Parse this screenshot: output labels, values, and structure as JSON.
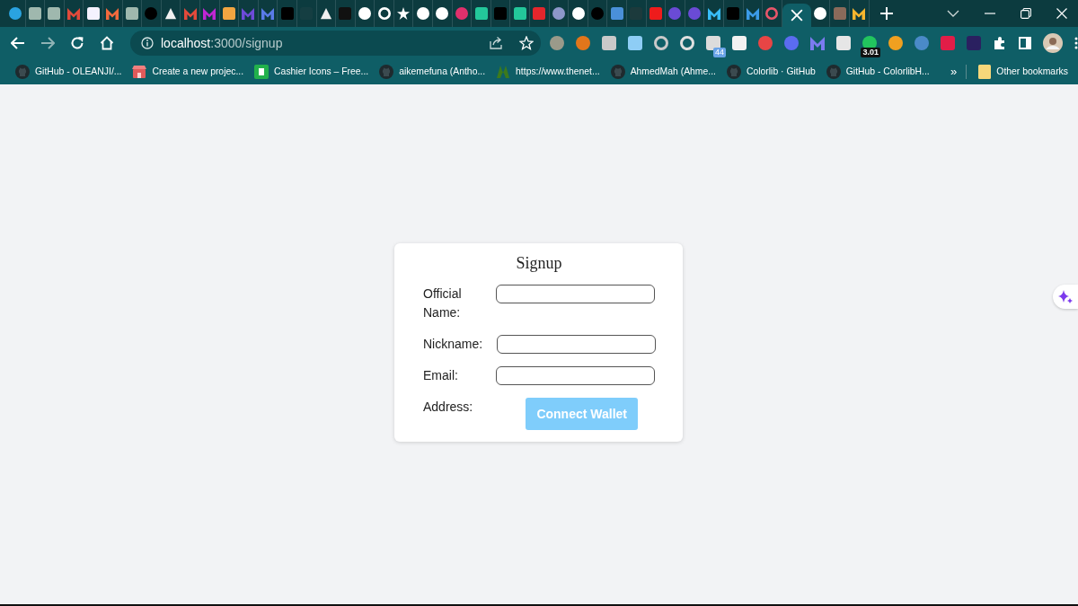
{
  "browser": {
    "tabs": [
      {
        "kind": "circle",
        "color": "#2aa3e0",
        "selected": false
      },
      {
        "kind": "square",
        "color": "#9fb8ae",
        "selected": false
      },
      {
        "kind": "square",
        "color": "#9fb8ae",
        "selected": false
      },
      {
        "kind": "mark",
        "color": "#e24a3b",
        "selected": false
      },
      {
        "kind": "square",
        "color": "#f4f2ff",
        "selected": false
      },
      {
        "kind": "mark",
        "color": "#f26a3d",
        "selected": false
      },
      {
        "kind": "square",
        "color": "#9fb8ae",
        "selected": false
      },
      {
        "kind": "circle",
        "color": "#000000",
        "selected": false
      },
      {
        "kind": "triangle",
        "color": "#f0f0f0",
        "selected": false
      },
      {
        "kind": "mark",
        "color": "#e24a3b",
        "selected": false
      },
      {
        "kind": "mark",
        "color": "#c026d3",
        "selected": false
      },
      {
        "kind": "square",
        "color": "#f2a541",
        "selected": false
      },
      {
        "kind": "mark",
        "color": "#6d4bd8",
        "selected": false
      },
      {
        "kind": "mark",
        "color": "#5a7be8",
        "selected": false
      },
      {
        "kind": "square",
        "color": "#000000",
        "selected": false
      },
      {
        "kind": "square",
        "color": "#153e42",
        "selected": false
      },
      {
        "kind": "triangle",
        "color": "#f0f0f0",
        "selected": false
      },
      {
        "kind": "square",
        "color": "#111111",
        "selected": false
      },
      {
        "kind": "circle",
        "color": "#ffffff",
        "selected": false
      },
      {
        "kind": "ring",
        "color": "#ffffff",
        "selected": false
      },
      {
        "kind": "star",
        "color": "#ffffff",
        "selected": false
      },
      {
        "kind": "circle",
        "color": "#ffffff",
        "selected": false
      },
      {
        "kind": "circle",
        "color": "#ffffff",
        "selected": false
      },
      {
        "kind": "circle",
        "color": "#e0306c",
        "selected": false
      },
      {
        "kind": "square",
        "color": "#23c79a",
        "selected": false
      },
      {
        "kind": "square",
        "color": "#000000",
        "selected": false
      },
      {
        "kind": "square",
        "color": "#23c79a",
        "selected": false
      },
      {
        "kind": "square",
        "color": "#e3262c",
        "selected": false
      },
      {
        "kind": "circle",
        "color": "#8d97c9",
        "selected": false
      },
      {
        "kind": "circle",
        "color": "#ffffff",
        "selected": false
      },
      {
        "kind": "circle",
        "color": "#000000",
        "selected": false
      },
      {
        "kind": "square",
        "color": "#4a90d9",
        "selected": false
      },
      {
        "kind": "square",
        "color": "#1c3a3c",
        "selected": false
      },
      {
        "kind": "square",
        "color": "#ee1c1c",
        "selected": false
      },
      {
        "kind": "circle",
        "color": "#6a4bd6",
        "selected": false
      },
      {
        "kind": "circle",
        "color": "#6a4bd6",
        "selected": false
      },
      {
        "kind": "mark",
        "color": "#38bdf8",
        "selected": false
      },
      {
        "kind": "square",
        "color": "#000000",
        "selected": false
      },
      {
        "kind": "mark",
        "color": "#3b9be8",
        "selected": false
      },
      {
        "kind": "ring",
        "color": "#e8566a",
        "selected": false
      },
      {
        "selected": true
      },
      {
        "kind": "circle",
        "color": "#ffffff",
        "selected": false
      },
      {
        "kind": "square",
        "color": "#8a6a5a",
        "selected": false
      },
      {
        "kind": "mark",
        "color": "#f5b52e",
        "selected": false
      }
    ],
    "address_bar": {
      "host": "localhost",
      "path": ":3000/signup"
    },
    "extensions": [
      {
        "kind": "circle",
        "color": "#9a9a8a"
      },
      {
        "kind": "circle",
        "color": "#e2761b"
      },
      {
        "kind": "square",
        "color": "#c9c9c9"
      },
      {
        "kind": "square",
        "color": "#8ecdf5"
      },
      {
        "kind": "ring",
        "color": "#c9c9c9"
      },
      {
        "kind": "ring",
        "color": "#e0e0e0"
      },
      {
        "kind": "square",
        "color": "#dcdcdc",
        "badge": "44"
      },
      {
        "kind": "square",
        "color": "#f2f2f2"
      },
      {
        "kind": "circle",
        "color": "#e84545"
      },
      {
        "kind": "circle",
        "color": "#5b6cf0"
      },
      {
        "kind": "mark",
        "color": "#7b7bf0"
      },
      {
        "kind": "square",
        "color": "#e6e6e6"
      },
      {
        "kind": "circle",
        "color": "#22c55e",
        "badge": "3.01"
      },
      {
        "kind": "circle",
        "color": "#f0a020"
      },
      {
        "kind": "circle",
        "color": "#4a8ac8"
      },
      {
        "kind": "square",
        "color": "#e11d48"
      },
      {
        "kind": "square",
        "color": "#2a2060"
      }
    ],
    "bookmarks": [
      {
        "kind": "github",
        "label": "GitHub - OLEANJI/..."
      },
      {
        "kind": "store",
        "label": "Create a new projec..."
      },
      {
        "kind": "sheet",
        "label": "Cashier Icons – Free..."
      },
      {
        "kind": "github",
        "label": "aikemefuna (Antho..."
      },
      {
        "kind": "leaf",
        "label": "https://www.thenet..."
      },
      {
        "kind": "github",
        "label": "AhmedMah (Ahme..."
      },
      {
        "kind": "github",
        "label": "Colorlib · GitHub"
      },
      {
        "kind": "github",
        "label": "GitHub - ColorlibH..."
      }
    ],
    "bookmarks_overflow": "»",
    "other_bookmarks": "Other bookmarks"
  },
  "form": {
    "title": "Signup",
    "fields": [
      {
        "kind": "input",
        "label": "Official Name:"
      },
      {
        "kind": "input",
        "label": "Nickname:"
      },
      {
        "kind": "input",
        "label": "Email:"
      },
      {
        "kind": "button",
        "label": "Address:",
        "button": "Connect Wallet",
        "disabled": true
      }
    ]
  }
}
